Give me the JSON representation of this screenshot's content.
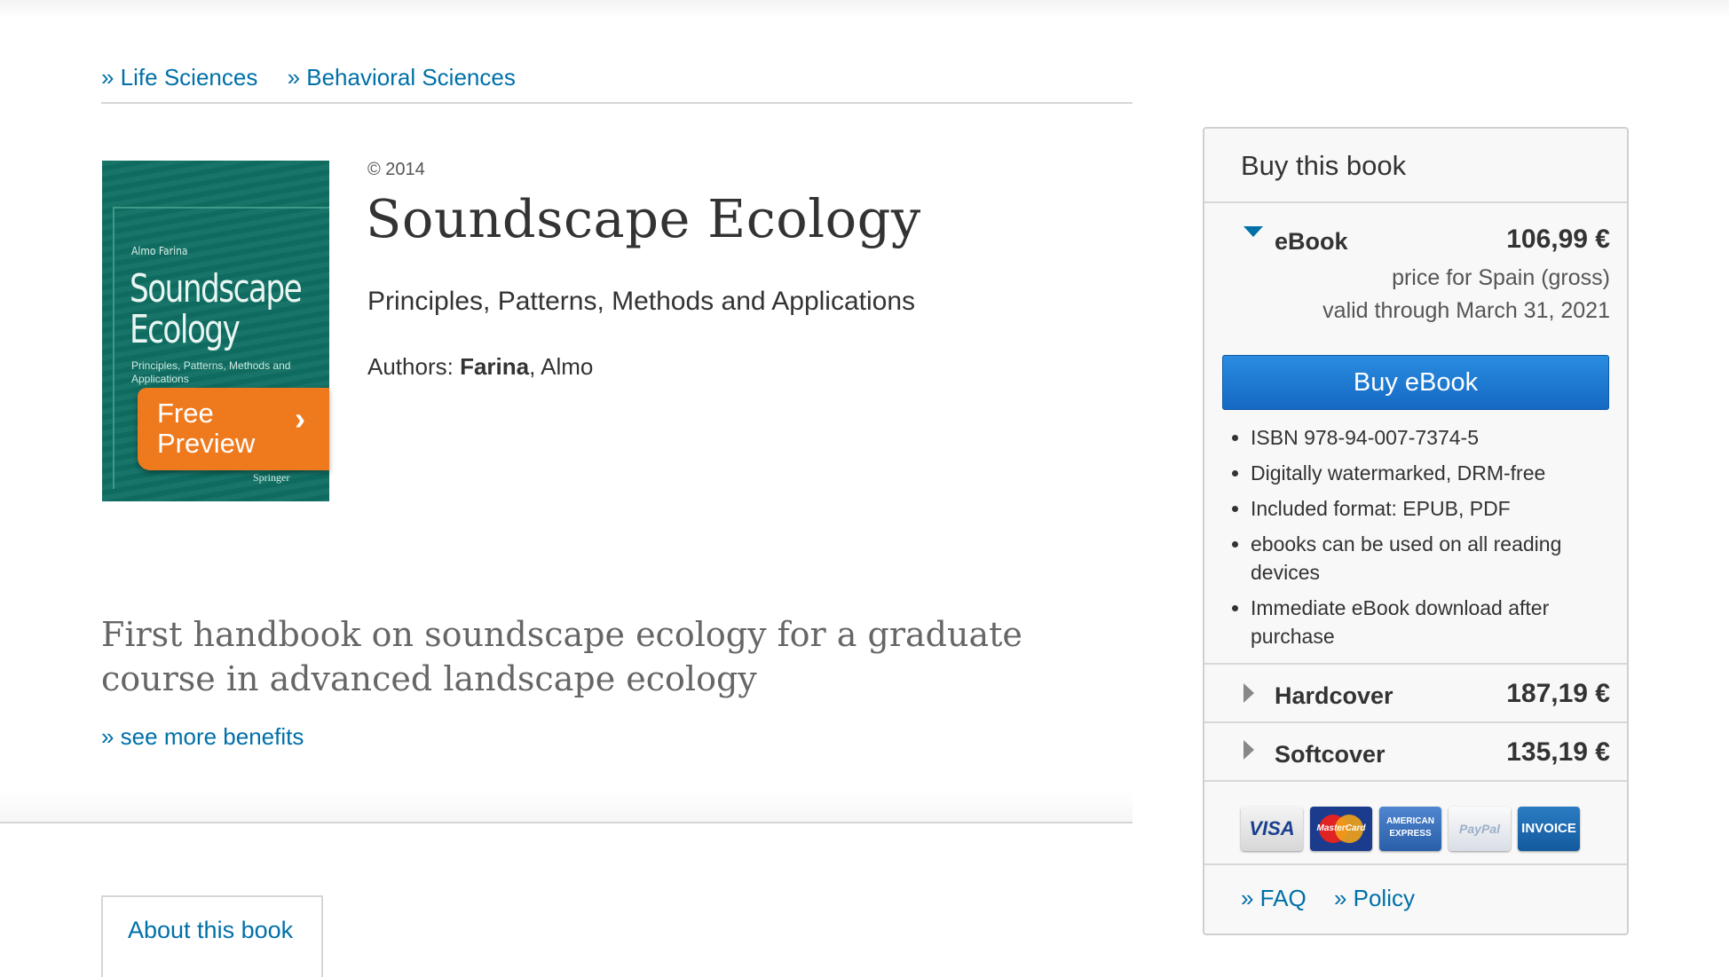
{
  "breadcrumb": {
    "items": [
      "» Life Sciences",
      "» Behavioral Sciences"
    ]
  },
  "cover": {
    "author": "Almo Farina",
    "title": "Soundscape Ecology",
    "subtitle": "Principles, Patterns, Methods and Applications",
    "publisher": "Springer",
    "preview_label": "Free Preview",
    "preview_chevron": "›"
  },
  "book": {
    "copyright": "© 2014",
    "title": "Soundscape Ecology",
    "subtitle": "Principles, Patterns, Methods and Applications",
    "authors_label": "Authors: ",
    "author_last": "Farina",
    "author_rest": ", Almo",
    "tagline": "First handbook on soundscape ecology for a graduate course  in advanced landscape ecology",
    "see_more": "» see more benefits"
  },
  "tabs": {
    "about": "About this book"
  },
  "buy": {
    "header": "Buy this book",
    "ebook": {
      "name": "eBook",
      "price": "106,99 €",
      "note_1": "price for Spain (gross)",
      "note_2": "valid through March 31, 2021",
      "button": "Buy eBook",
      "features": [
        "ISBN 978-94-007-7374-5",
        "Digitally watermarked, DRM-free",
        "Included format: EPUB, PDF",
        "ebooks can be used on all reading devices",
        "Immediate eBook download after purchase"
      ]
    },
    "hardcover": {
      "name": "Hardcover",
      "price": "187,19 €"
    },
    "softcover": {
      "name": "Softcover",
      "price": "135,19 €"
    },
    "payment_methods": {
      "visa": "VISA",
      "mastercard": "MasterCard",
      "amex": "AMERICAN EXPRESS",
      "paypal": "PayPal",
      "invoice": "INVOICE"
    },
    "links": {
      "faq": "» FAQ",
      "policy": "» Policy"
    }
  },
  "colors": {
    "link": "#0070a8",
    "buy_button": "#1a74cf",
    "cover": "#0f6e63",
    "preview": "#ef7a1e"
  }
}
